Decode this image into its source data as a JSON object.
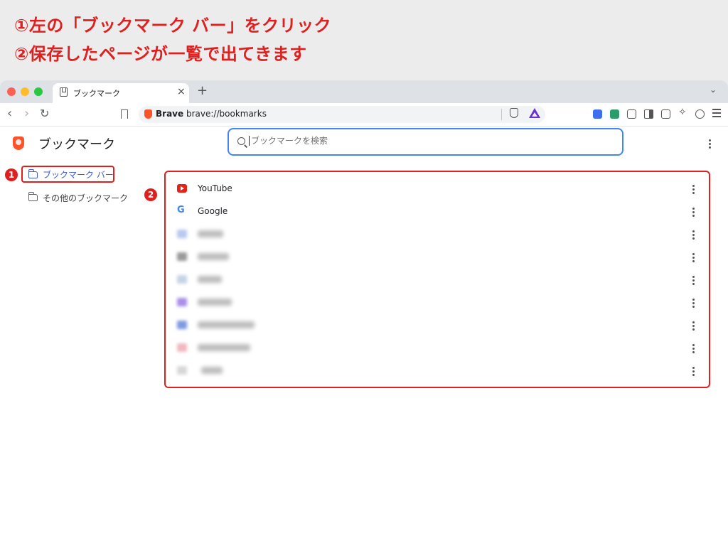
{
  "instructions": {
    "line1": "①左の「ブックマーク バー」をクリック",
    "line2": "②保存したページが一覧で出てきます"
  },
  "tab": {
    "title": "ブックマーク",
    "close": "×",
    "new_tab": "+"
  },
  "toolbar": {
    "back": "‹",
    "forward": "›",
    "reload": "↻",
    "brave_label": "Brave",
    "url": "brave://bookmarks"
  },
  "page": {
    "title": "ブックマーク",
    "search_placeholder": "ブックマークを検索"
  },
  "sidebar": {
    "items": [
      {
        "label": "ブックマーク バー",
        "selected": true
      },
      {
        "label": "その他のブックマーク",
        "selected": false
      }
    ]
  },
  "annotations": {
    "badge1": "1",
    "badge2": "2"
  },
  "bookmarks": [
    {
      "title": "YouTube",
      "icon": "youtube-icon"
    },
    {
      "title": "Google",
      "icon": "google-icon"
    }
  ],
  "colors": {
    "accent_red": "#e01f1f",
    "brave_orange": "#fb542b",
    "link_blue": "#3b5bd9"
  }
}
